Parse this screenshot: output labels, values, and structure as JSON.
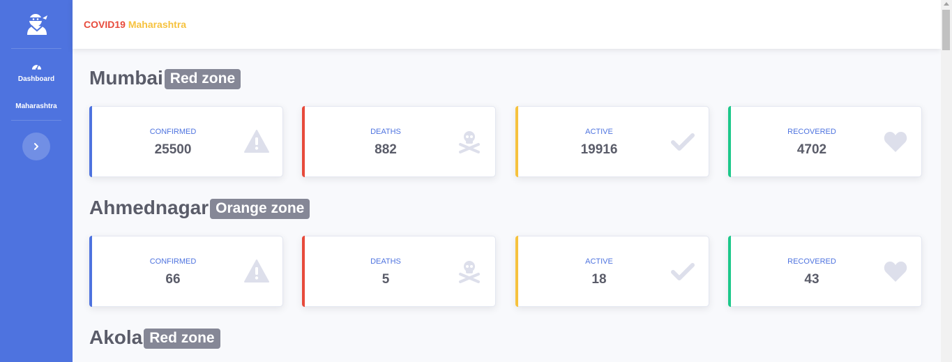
{
  "app": {
    "title_part1": "COVID19",
    "title_part2": "Maharashtra"
  },
  "sidebar": {
    "brand_icon": "ninja-user-icon",
    "items": [
      {
        "label": "Dashboard",
        "icon": "tachometer-icon"
      },
      {
        "label": "Maharashtra"
      }
    ],
    "toggle_icon": "chevron-right-icon"
  },
  "colors": {
    "primary": "#4e73df",
    "danger": "#e74a3b",
    "warning": "#f6c23e",
    "success": "#1cc88a",
    "badge": "#858796"
  },
  "districts": [
    {
      "name": "Mumbai",
      "zone": "Red zone",
      "stats": [
        {
          "label": "CONFIRMED",
          "value": "25500",
          "icon": "exclamation-triangle-icon"
        },
        {
          "label": "DEATHS",
          "value": "882",
          "icon": "skull-crossbones-icon"
        },
        {
          "label": "ACTIVE",
          "value": "19916",
          "icon": "check-icon"
        },
        {
          "label": "RECOVERED",
          "value": "4702",
          "icon": "heart-icon"
        }
      ]
    },
    {
      "name": "Ahmednagar",
      "zone": "Orange zone",
      "stats": [
        {
          "label": "CONFIRMED",
          "value": "66",
          "icon": "exclamation-triangle-icon"
        },
        {
          "label": "DEATHS",
          "value": "5",
          "icon": "skull-crossbones-icon"
        },
        {
          "label": "ACTIVE",
          "value": "18",
          "icon": "check-icon"
        },
        {
          "label": "RECOVERED",
          "value": "43",
          "icon": "heart-icon"
        }
      ]
    },
    {
      "name": "Akola",
      "zone": "Red zone"
    }
  ]
}
